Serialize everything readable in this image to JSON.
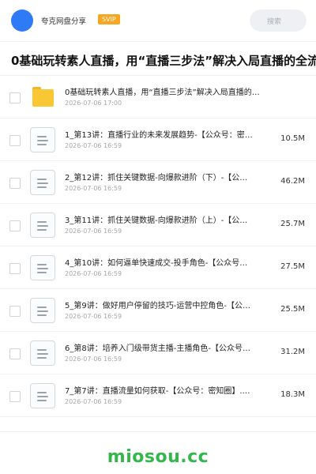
{
  "header": {
    "share_title": "夸克网盘分享",
    "badge": "SVIP",
    "search_placeholder": "搜索",
    "avatar_color": "#2f7bf6",
    "badge_color": "#f5a623"
  },
  "folder_title": "0基础玩转素人直播，用“直播三步法”解决入局直播的全流",
  "files": [
    {
      "name": "0基础玩转素人直播，用“直播三步法”解决入局直播的…",
      "date": "2026-07-06 17:00",
      "size": "",
      "icon": "folder-icon"
    },
    {
      "name": "1_第13讲：直播行业的未来发展趋势-【公众号：密…",
      "date": "2026-07-06 16:59",
      "size": "10.5M",
      "icon": "document-icon"
    },
    {
      "name": "2_第12讲：抓住关键数据-向爆款进阶（下）-【公…",
      "date": "2026-07-06 16:59",
      "size": "46.2M",
      "icon": "document-icon"
    },
    {
      "name": "3_第11讲：抓住关键数据-向爆款进阶（上）-【公…",
      "date": "2026-07-06 16:59",
      "size": "25.7M",
      "icon": "document-icon"
    },
    {
      "name": "4_第10讲：如何逼单快速成交-投手角色-【公众号…",
      "date": "2026-07-06 16:59",
      "size": "27.5M",
      "icon": "document-icon"
    },
    {
      "name": "5_第9讲：做好用户停留的技巧-运营中控角色-【公…",
      "date": "2026-07-06 16:59",
      "size": "25.5M",
      "icon": "document-icon"
    },
    {
      "name": "6_第8讲：培养入门级带货主播-主播角色-【公众号…",
      "date": "2026-07-06 16:59",
      "size": "31.2M",
      "icon": "document-icon"
    },
    {
      "name": "7_第7讲：直播流量如何获取-【公众号：密知圈】.…",
      "date": "2026-07-06 16:59",
      "size": "18.3M",
      "icon": "document-icon"
    }
  ],
  "watermark": "miosou.cc",
  "watermark_color": "#33b64a"
}
